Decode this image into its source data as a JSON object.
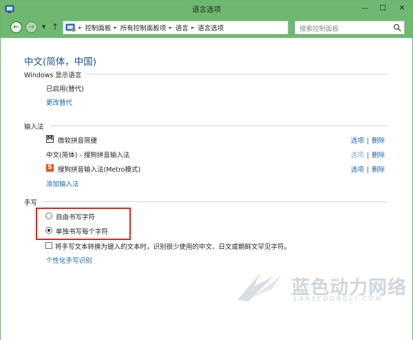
{
  "window": {
    "title": "语言选项"
  },
  "titlebar_buttons": {
    "minimize": "—",
    "maximize": "☐",
    "close": "✕"
  },
  "address": {
    "crumbs": [
      "控制面板",
      "所有控制面板项",
      "语言",
      "语言选项"
    ]
  },
  "search": {
    "placeholder": "搜索控制面板"
  },
  "main": {
    "title": "中文(简体，中国)",
    "display_language": {
      "heading": "Windows 显示语言",
      "status": "已启用(替代)",
      "change_link": "更改替代"
    },
    "input_methods": {
      "heading": "输入法",
      "items": [
        {
          "icon": "M",
          "label": "微软拼音简捷",
          "options": "选项",
          "remove": "删除",
          "options_enabled": true
        },
        {
          "icon": "",
          "label": "中文(简体) - 搜狗拼音输入法",
          "options": "选项",
          "remove": "删除",
          "options_enabled": false
        },
        {
          "icon": "S",
          "label": "搜狗拼音输入法(Metro模式)",
          "options": "选项",
          "remove": "删除",
          "options_enabled": true
        }
      ],
      "add_link": "添加输入法"
    },
    "handwriting": {
      "heading": "手写",
      "radio_free": {
        "label": "自由书写字符",
        "checked": false
      },
      "radio_single": {
        "label": "单独书写每个字符",
        "checked": true
      },
      "checkbox": {
        "label": "将手写文本转换为键入的文本时，识别很少使用的中文、日文或朝鲜文罕见字符。",
        "checked": false
      },
      "personalize_link": "个性化手写识别"
    }
  },
  "watermark": {
    "text": "蓝色动力网络",
    "sub": "LANSEDONGLI.COM"
  },
  "colors": {
    "titlebar": "#6fb871",
    "link": "#1565b0",
    "highlight_box": "#d9261c"
  }
}
